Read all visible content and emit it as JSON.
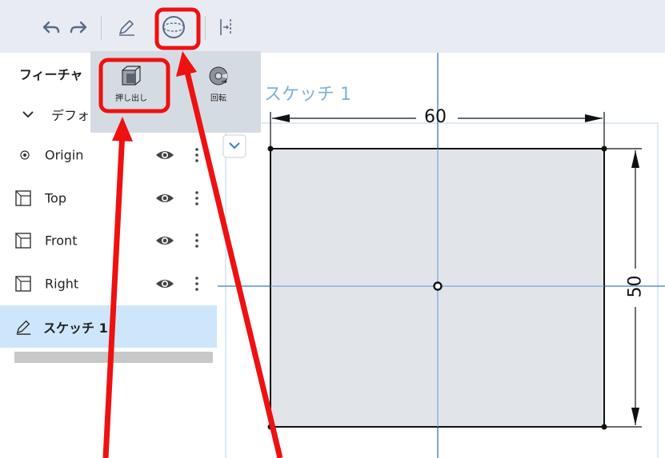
{
  "toolbar": {
    "undo_icon": "undo-icon",
    "redo_icon": "redo-icon",
    "sketch_icon": "pencil-icon",
    "solid_icon": "solid-sphere-icon",
    "constraint_icon": "constraint-icon"
  },
  "sidebar": {
    "header": "フィーチャ",
    "default_group": "デフォ",
    "items": [
      {
        "label": "Origin",
        "icon": "origin-icon"
      },
      {
        "label": "Top",
        "icon": "plane-icon"
      },
      {
        "label": "Front",
        "icon": "plane-icon"
      },
      {
        "label": "Right",
        "icon": "plane-icon"
      }
    ],
    "sketch_item": "スケッチ 1"
  },
  "popup": {
    "extrude_label": "押し出し",
    "revolve_label": "回転"
  },
  "canvas": {
    "sketch_title": "スケッチ 1",
    "dim_width": "60",
    "dim_height": "50"
  },
  "colors": {
    "annotation": "#ee1111",
    "selection": "#cde6fb",
    "toolbar_bg": "#e8ecf2",
    "popup_bg": "#d5dbe2",
    "axis_blue": "#5b8fd8"
  }
}
